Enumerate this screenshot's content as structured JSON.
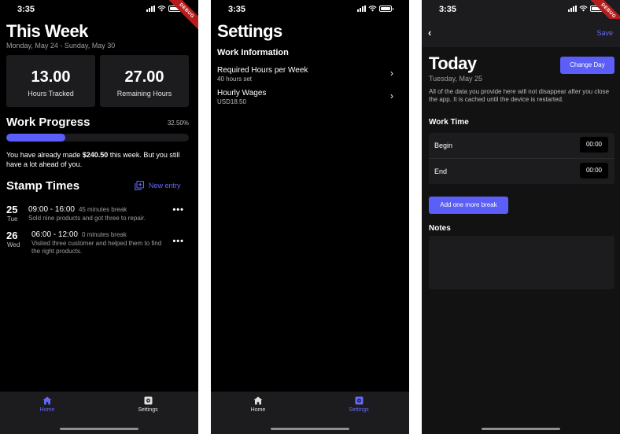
{
  "status_time": "3:35",
  "debug_label": "DEBUG",
  "home": {
    "title": "This Week",
    "date_range": "Monday, May 24 - Sunday, May 30",
    "hours_tracked_value": "13.00",
    "hours_tracked_label": "Hours Tracked",
    "remaining_value": "27.00",
    "remaining_label": "Remaining Hours",
    "progress_title": "Work Progress",
    "progress_percent_text": "32.50%",
    "progress_fraction": 0.325,
    "earned_prefix": "You have already made ",
    "earned_amount": "$240.50",
    "earned_suffix": " this week. But you still have a lot ahead of you.",
    "stamp_title": "Stamp Times",
    "new_entry": "New entry",
    "entries": [
      {
        "day": "25",
        "dow": "Tue",
        "range": "09:00 - 16:00",
        "break": "45 minutes break",
        "note": "Sold nine products and got three to repair."
      },
      {
        "day": "26",
        "dow": "Wed",
        "range": "06:00 - 12:00",
        "break": "0 minutes break",
        "note": "Visited three customer and helped them to find the right products."
      }
    ]
  },
  "nav": {
    "home": "Home",
    "settings": "Settings"
  },
  "settings": {
    "title": "Settings",
    "section": "Work Information",
    "rows": [
      {
        "title": "Required Hours per Week",
        "value": "40 hours set"
      },
      {
        "title": "Hourly Wages",
        "value": "USD18.50"
      }
    ]
  },
  "today": {
    "save": "Save",
    "title": "Today",
    "date": "Tuesday, May 25",
    "change_day": "Change Day",
    "info": "All of the data you provide here will not disappear after you close the app. It is cached until the device is restarted.",
    "work_time_title": "Work Time",
    "begin_label": "Begin",
    "begin_value": "00:00",
    "end_label": "End",
    "end_value": "00:00",
    "add_break": "Add one more break",
    "notes_title": "Notes"
  },
  "colors": {
    "accent": "#5b5ef7",
    "link": "#6468ff",
    "surface": "#1c1c1e",
    "background": "#000000"
  }
}
